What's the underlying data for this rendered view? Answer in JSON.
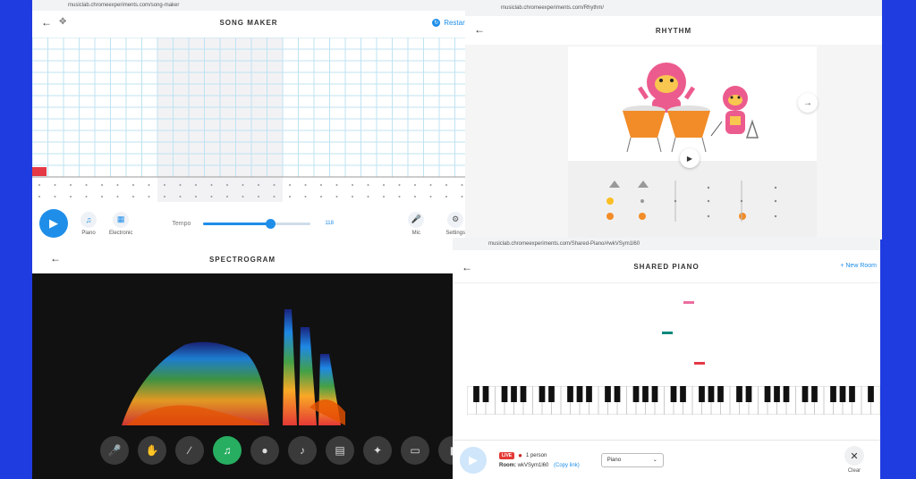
{
  "song_maker": {
    "url": "musiclab.chromeexperiments.com/song-maker",
    "title": "SONG MAKER",
    "restart_label": "Restart",
    "controls": {
      "piano_label": "Piano",
      "electronic_label": "Electronic",
      "tempo_label": "Tempo",
      "tempo_value": "118",
      "mic_label": "Mic",
      "settings_label": "Settings"
    }
  },
  "rhythm": {
    "url": "musiclab.chromeexperiments.com/Rhythm/",
    "title": "RHYTHM"
  },
  "spectrogram": {
    "title": "SPECTROGRAM",
    "tools": [
      "microphone-icon",
      "hand-icon",
      "flute-icon",
      "saxophone-icon",
      "whistle-icon",
      "trumpet-icon",
      "keyboard-icon",
      "bird-icon",
      "laptop-icon",
      "phone-icon"
    ]
  },
  "shared_piano": {
    "url": "musiclab.chromeexperiments.com/Shared-Piano/#wkVSym1l60",
    "title": "SHARED PIANO",
    "new_room_label": "+ New Room",
    "live_label": "LIVE",
    "people_label": "1 person",
    "room_label": "Room:",
    "room_code": "wkVSym1l60",
    "copy_link_label": "(Copy link)",
    "instrument": "Piano",
    "clear_label": "Clear",
    "colors": {
      "pink": "#ec6fa0",
      "teal": "#00897b",
      "red": "#e53945"
    }
  }
}
